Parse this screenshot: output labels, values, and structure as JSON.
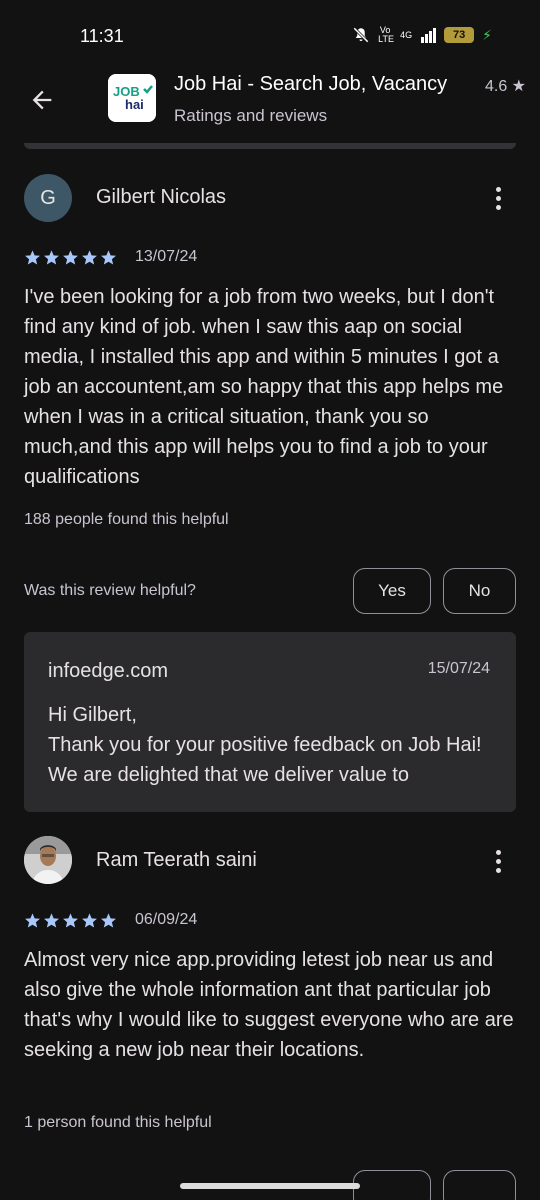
{
  "status_bar": {
    "time": "11:31",
    "network_volte": "Vo LTE",
    "network_type": "4G",
    "battery_level": "73"
  },
  "header": {
    "app_name": "Job Hai - Search Job, Vacancy",
    "subtitle": "Ratings and reviews",
    "rating": "4.6 ★",
    "logo_text_top": "JOB",
    "logo_text_bottom": "hai"
  },
  "reviews": [
    {
      "avatar_letter": "G",
      "reviewer": "Gilbert Nicolas",
      "stars": 5,
      "date": "13/07/24",
      "text": "I've been looking for a job from two weeks, but I don't find any kind of job. when I saw this aap on social media, I installed this app and within 5 minutes I got a job an accountent,am so happy that this app helps me when I was in a critical situation, thank you so much,and this app will helps you to find a job to your qualifications",
      "helpful_count": "188 people found this helpful",
      "helpful_question": "Was this review helpful?",
      "yes_label": "Yes",
      "no_label": "No",
      "reply": {
        "developer": "infoedge.com",
        "date": "15/07/24",
        "text": "Hi Gilbert,\nThank you for your positive feedback on Job Hai! We are delighted that we deliver value to"
      }
    },
    {
      "reviewer": "Ram Teerath saini",
      "stars": 5,
      "date": "06/09/24",
      "text": "Almost very nice app.providing letest job near us and also give the whole information ant that particular job that's why I would like to suggest everyone who are are seeking a new job near their locations.",
      "helpful_count": "1 person found this helpful"
    }
  ],
  "colors": {
    "background": "#121212",
    "star": "#a8c7fa",
    "reply_card": "#2b2b2d",
    "avatar_bg": "#3e5766",
    "logo_green": "#16a085",
    "logo_navy": "#1b2a6b"
  },
  "icons": [
    "back-arrow-icon",
    "more-vert-icon",
    "star-icon",
    "mute-icon",
    "signal-icon",
    "battery-icon",
    "charging-icon"
  ]
}
